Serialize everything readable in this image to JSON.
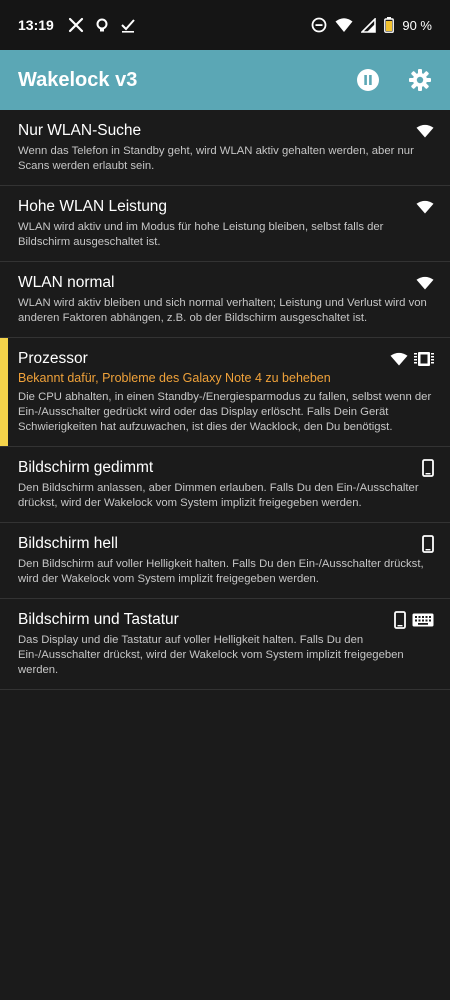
{
  "status_bar": {
    "time": "13:19",
    "battery": "90 %"
  },
  "app_bar": {
    "title": "Wakelock v3"
  },
  "items": [
    {
      "title": "Nur WLAN-Suche",
      "description": "Wenn das Telefon in Standby geht, wird WLAN aktiv gehalten werden, aber nur Scans werden erlaubt sein."
    },
    {
      "title": "Hohe WLAN Leistung",
      "description": "WLAN wird aktiv und im Modus für hohe Leistung bleiben, selbst falls der Bildschirm ausgeschaltet ist."
    },
    {
      "title": "WLAN normal",
      "description": "WLAN wird aktiv bleiben und sich normal verhalten; Leistung und Verlust wird von anderen Faktoren abhängen, z.B. ob der Bildschirm ausgeschaltet ist."
    },
    {
      "title": "Prozessor",
      "warning": "Bekannt dafür, Probleme des Galaxy Note 4 zu beheben",
      "description": "Die CPU abhalten, in einen Standby-/Energiesparmodus zu fallen, selbst wenn der Ein-/Ausschalter gedrückt wird oder das Display erlöscht. Falls Dein Gerät Schwierigkeiten hat aufzuwachen, ist dies der Wacklock, den Du benötigst."
    },
    {
      "title": "Bildschirm gedimmt",
      "description": "Den Bildschirm anlassen, aber Dimmen erlauben. Falls Du den Ein-/Ausschalter drückst, wird der Wakelock vom System implizit freigegeben werden."
    },
    {
      "title": "Bildschirm hell",
      "description": "Den Bildschirm auf voller Helligkeit halten. Falls Du den Ein-/Ausschalter drückst, wird der Wakelock vom System implizit freigegeben werden."
    },
    {
      "title": "Bildschirm und Tastatur",
      "description": "Das Display und die Tastatur auf voller Helligkeit halten. Falls Du den Ein-/Ausschalter drückst, wird der Wakelock vom System implizit freigegeben werden."
    }
  ],
  "colors": {
    "app_bar": "#5ba7b5",
    "background": "#1b1b1b",
    "selected_accent": "#f4d34a",
    "warning_text": "#f0a23a"
  },
  "icons": {
    "status_left": [
      "x-icon",
      "lightbulb-icon",
      "checkmark-icon"
    ],
    "status_right": [
      "do-not-disturb-icon",
      "wifi-icon",
      "signal-icon",
      "battery-icon"
    ],
    "app_bar": [
      "pause-icon",
      "gear-icon"
    ]
  }
}
